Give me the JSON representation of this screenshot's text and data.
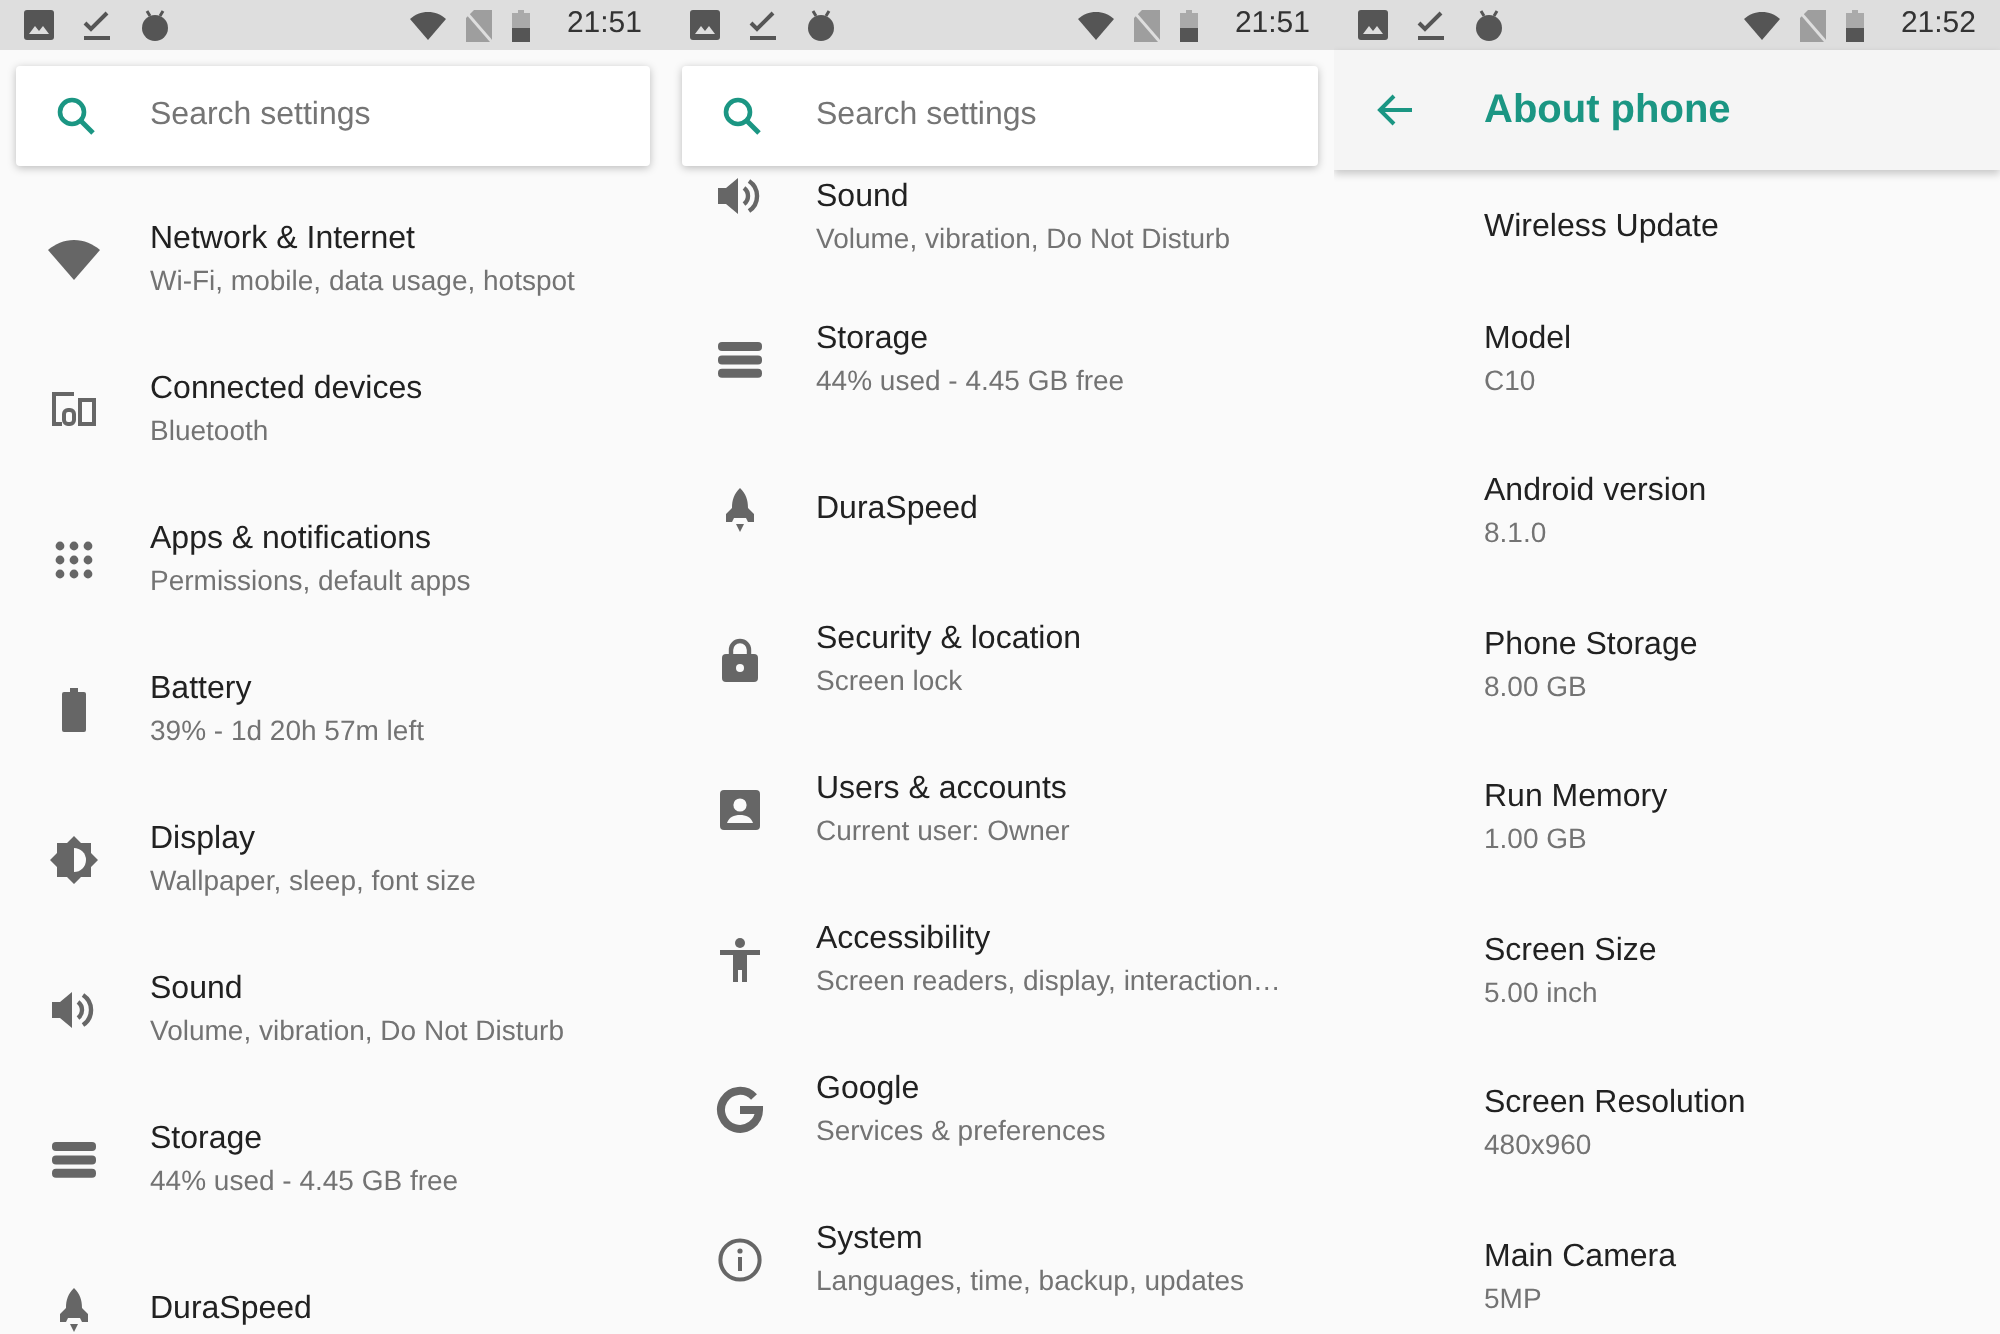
{
  "panels": [
    {
      "kind": "settings",
      "status_bar": {
        "time": "21:51"
      },
      "search": {
        "placeholder": "Search settings"
      },
      "items": [
        {
          "title": "Network & Internet",
          "subtitle": "Wi-Fi, mobile, data usage, hotspot"
        },
        {
          "title": "Connected devices",
          "subtitle": "Bluetooth"
        },
        {
          "title": "Apps & notifications",
          "subtitle": "Permissions, default apps"
        },
        {
          "title": "Battery",
          "subtitle": "39% - 1d 20h 57m left"
        },
        {
          "title": "Display",
          "subtitle": "Wallpaper, sleep, font size"
        },
        {
          "title": "Sound",
          "subtitle": "Volume, vibration, Do Not Disturb"
        },
        {
          "title": "Storage",
          "subtitle": "44% used - 4.45 GB free"
        },
        {
          "title": "DuraSpeed"
        }
      ]
    },
    {
      "kind": "settings",
      "status_bar": {
        "time": "21:51"
      },
      "search": {
        "placeholder": "Search settings"
      },
      "items": [
        {
          "title": "Sound",
          "subtitle": "Volume, vibration, Do Not Disturb"
        },
        {
          "title": "Storage",
          "subtitle": "44% used - 4.45 GB free"
        },
        {
          "title": "DuraSpeed"
        },
        {
          "title": "Security & location",
          "subtitle": "Screen lock"
        },
        {
          "title": "Users & accounts",
          "subtitle": "Current user: Owner"
        },
        {
          "title": "Accessibility",
          "subtitle": "Screen readers, display, interaction…"
        },
        {
          "title": "Google",
          "subtitle": "Services & preferences"
        },
        {
          "title": "System",
          "subtitle": "Languages, time, backup, updates"
        }
      ]
    },
    {
      "kind": "about",
      "status_bar": {
        "time": "21:52"
      },
      "app_bar": {
        "title": "About phone"
      },
      "items": [
        {
          "title": "Wireless Update"
        },
        {
          "title": "Model",
          "value": "C10"
        },
        {
          "title": "Android version",
          "value": "8.1.0"
        },
        {
          "title": "Phone Storage",
          "value": "8.00 GB"
        },
        {
          "title": "Run Memory",
          "value": "1.00 GB"
        },
        {
          "title": "Screen Size",
          "value": "5.00 inch"
        },
        {
          "title": "Screen Resolution",
          "value": "480x960"
        },
        {
          "title": "Main Camera",
          "value": "5MP"
        }
      ]
    }
  ]
}
